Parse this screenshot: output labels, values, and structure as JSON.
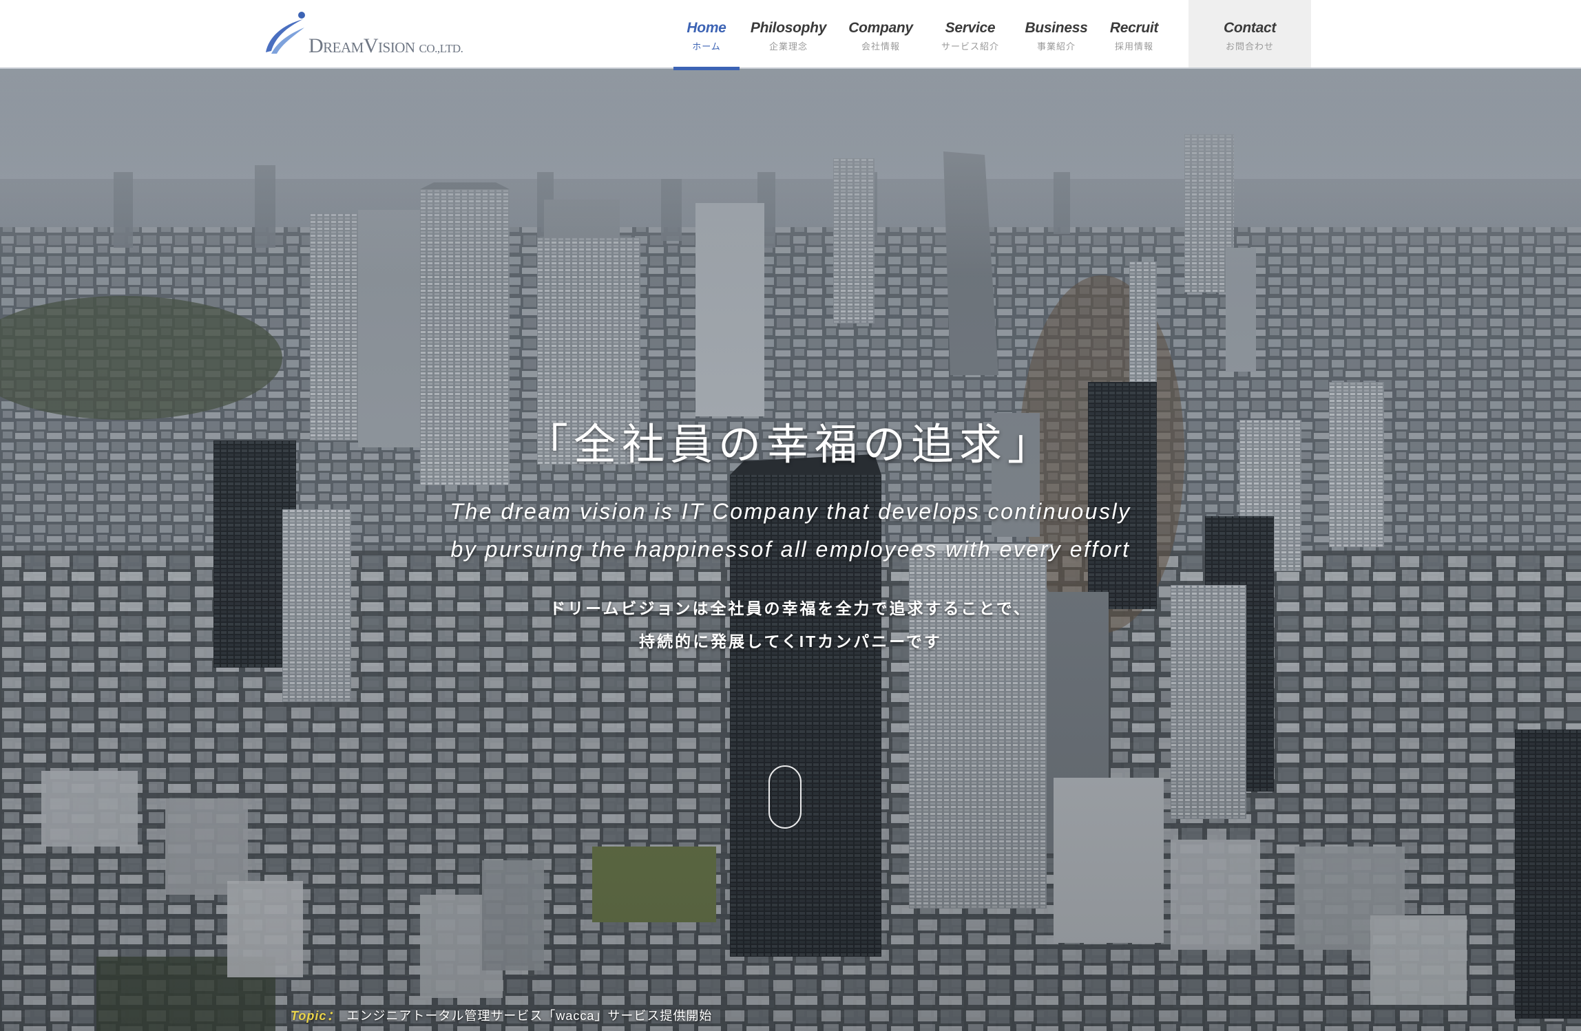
{
  "header": {
    "logo": {
      "name_big_1": "D",
      "name_small_1": "REAM",
      "name_big_2": "V",
      "name_small_2": "ISION",
      "suffix": "CO.,LTD."
    },
    "nav": [
      {
        "en": "Home",
        "jp": "ホーム",
        "active": true
      },
      {
        "en": "Philosophy",
        "jp": "企業理念"
      },
      {
        "en": "Company",
        "jp": "会社情報"
      },
      {
        "en": "Service",
        "jp": "サービス紹介"
      },
      {
        "en": "Business",
        "jp": "事業紹介"
      },
      {
        "en": "Recruit",
        "jp": "採用情報"
      },
      {
        "en": "Contact",
        "jp": "お問合わせ"
      }
    ],
    "accent_color": "#3c63b4"
  },
  "hero": {
    "title": "「全社員の幸福の追求」",
    "en_line1": "The dream vision is IT Company that develops continuously",
    "en_line2": "by pursuing the happinessof all employees with every effort",
    "jp_line1": "ドリームビジョンは全社員の幸福を全力で追求することで、",
    "jp_line2": "持続的に発展してくITカンパニーです",
    "background": "aerial-city-photo"
  },
  "topic": {
    "label": "Topic：",
    "text": "エンジニアトータル管理サービス「wacca」サービス提供開始",
    "label_color": "#e9d34a"
  }
}
